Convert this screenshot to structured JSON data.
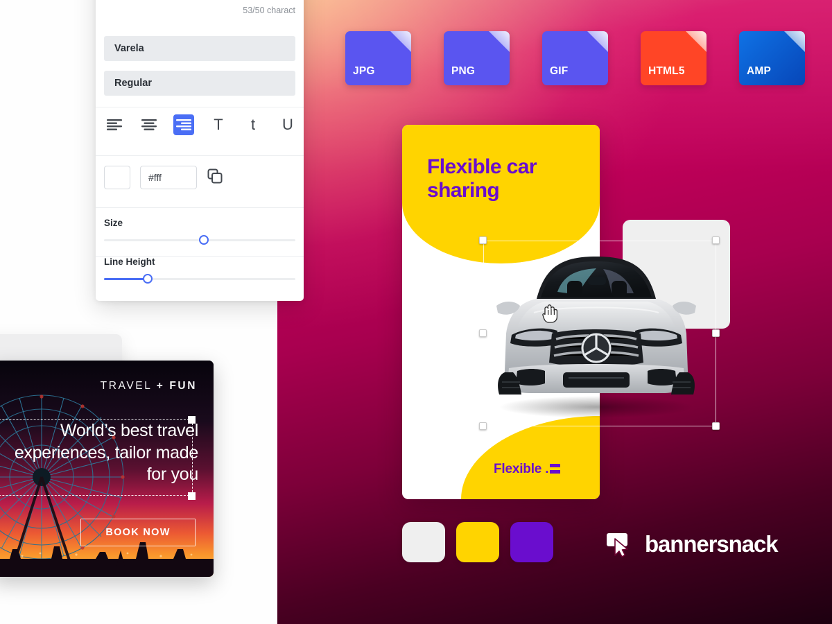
{
  "app": {
    "name": "bannersnack",
    "logo_text": "bannersnack"
  },
  "theme": {
    "brand_yellow": "#FFD400",
    "brand_purple": "#6A0DCE",
    "accent_blue": "#4a6ef5",
    "gradient_from": "#FFCD8C",
    "gradient_mid": "#D5005C",
    "gradient_to": "#1D0010"
  },
  "export_formats": [
    {
      "label": "JPG",
      "color": "#5A55F0"
    },
    {
      "label": "PNG",
      "color": "#5A55F0"
    },
    {
      "label": "GIF",
      "color": "#5A55F0"
    },
    {
      "label": "HTML5",
      "color": "#FF4526"
    },
    {
      "label": "AMP",
      "color": "#0B62D6"
    }
  ],
  "text_panel": {
    "input_value": "",
    "input_placeholder": "",
    "char_count": "53/50 charact",
    "font_family": "Varela",
    "font_weight": "Regular",
    "align_tools": [
      {
        "name": "align-left-icon",
        "active": false
      },
      {
        "name": "align-center-icon",
        "active": false
      },
      {
        "name": "align-right-icon",
        "active": true
      }
    ],
    "case_tools": [
      {
        "label": "T",
        "name": "uppercase-icon"
      },
      {
        "label": "t",
        "name": "lowercase-icon"
      },
      {
        "label": "U",
        "name": "underline-icon"
      }
    ],
    "color": {
      "swatch_hex": "#ffffff",
      "value": "#fff",
      "copy_icon": "copy-icon"
    },
    "sliders": [
      {
        "label": "Size",
        "percent": 52,
        "filled": false
      },
      {
        "label": "Line Height",
        "percent": 23,
        "filled": true
      }
    ]
  },
  "banner": {
    "title": "Flexible car sharing",
    "subtitle": "Flexible .",
    "background": "#ffffff",
    "blob_color": "#FFD400",
    "title_color": "#6A0DCE",
    "image_alt": "silver-sedan-front-view",
    "cursor": "grab-hand-cursor"
  },
  "color_swatches": [
    {
      "name": "swatch-white",
      "hex": "#EFEFEF"
    },
    {
      "name": "swatch-yellow",
      "hex": "#FFD400"
    },
    {
      "name": "swatch-purple",
      "hex": "#6A0DCE"
    }
  ],
  "travel_banner": {
    "brand_light": "TRAVEL",
    "brand_plus": "+",
    "brand_bold": "FUN",
    "headline": "World’s best travel experiences, tailor made for you",
    "cta": "BOOK NOW",
    "image_alt": "ferris-wheel-at-sunset"
  }
}
